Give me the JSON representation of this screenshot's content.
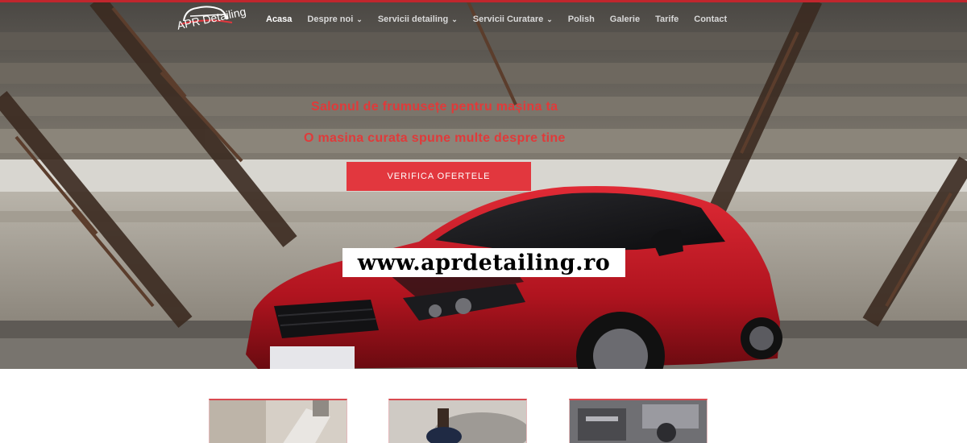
{
  "site": {
    "logo_text": "APR Detailing"
  },
  "nav": {
    "items": [
      {
        "label": "Acasa",
        "active": true,
        "dropdown": false
      },
      {
        "label": "Despre noi",
        "active": false,
        "dropdown": true
      },
      {
        "label": "Servicii detailing",
        "active": false,
        "dropdown": true
      },
      {
        "label": "Servicii Curatare",
        "active": false,
        "dropdown": true
      },
      {
        "label": "Polish",
        "active": false,
        "dropdown": false
      },
      {
        "label": "Galerie",
        "active": false,
        "dropdown": false
      },
      {
        "label": "Tarife",
        "active": false,
        "dropdown": false
      },
      {
        "label": "Contact",
        "active": false,
        "dropdown": false
      }
    ]
  },
  "hero": {
    "tagline_1": "Salonul de frumusețe pentru mașina ta",
    "tagline_2": "O masina curata spune multe despre tine",
    "cta_label": "VERIFICA OFERTELE",
    "watermark": "www.aprdetailing.ro"
  },
  "colors": {
    "accent": "#e2373e",
    "tagline": "#e03a3a",
    "car": "#c8202a"
  }
}
